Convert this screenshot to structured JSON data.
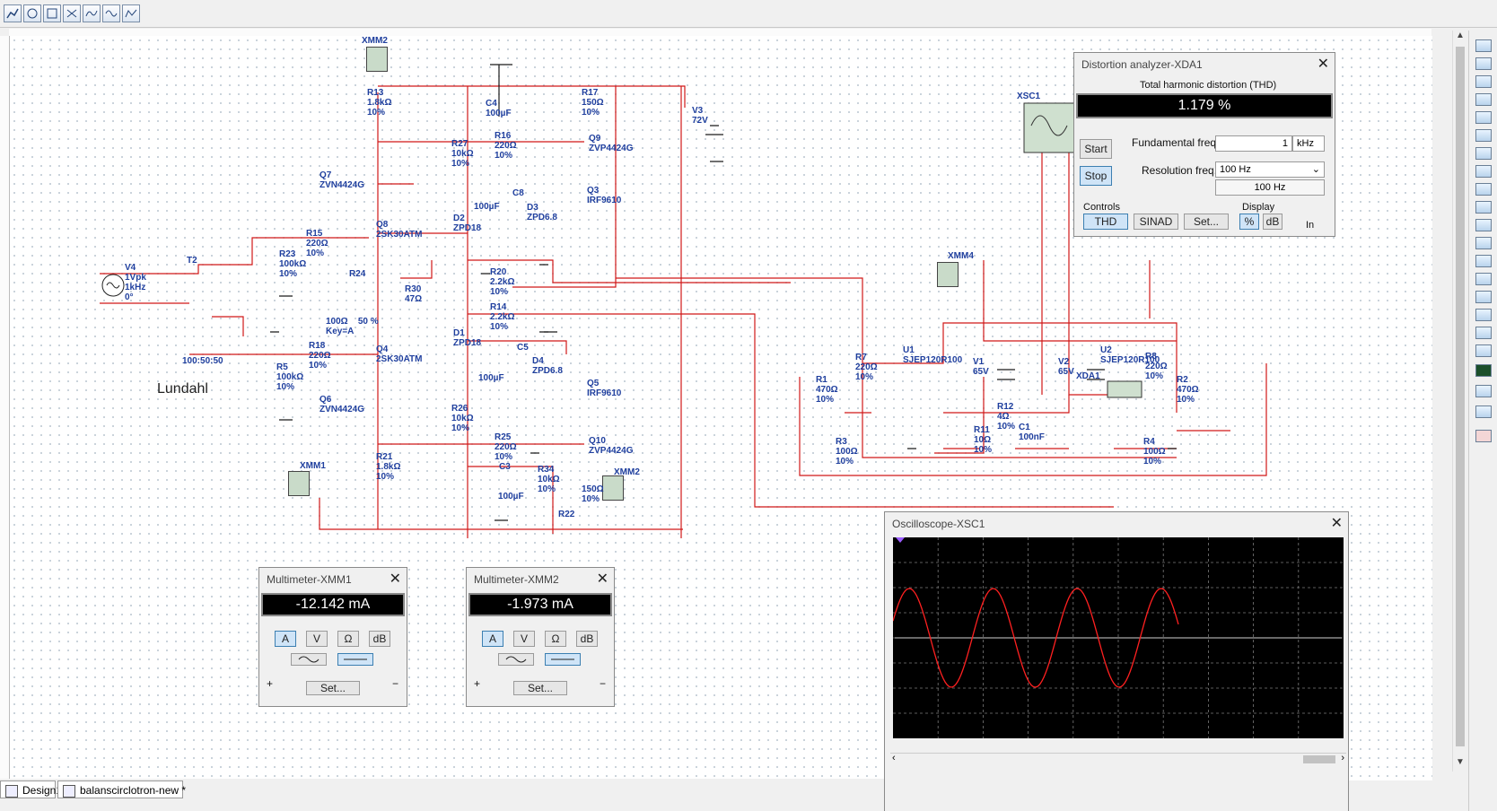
{
  "toolbar": {
    "buttons": [
      "probe-icon",
      "oscilloscope-icon",
      "spectrum-icon",
      "bode-icon",
      "grapher-icon",
      "waveform-icon",
      "network-icon"
    ]
  },
  "tabs": [
    {
      "label": "Design1"
    },
    {
      "label": "balanscirclotron-new *"
    }
  ],
  "schematic": {
    "components": [
      {
        "id": "xmm2_top",
        "text": "XMM2"
      },
      {
        "id": "r13",
        "text": "R13\n1.8kΩ\n10%"
      },
      {
        "id": "c4",
        "text": "C4\n100µF"
      },
      {
        "id": "r17",
        "text": "R17\n150Ω\n10%"
      },
      {
        "id": "v3",
        "text": "V3\n72V"
      },
      {
        "id": "r27",
        "text": "R27\n10kΩ\n10%"
      },
      {
        "id": "r16",
        "text": "R16\n220Ω\n10%"
      },
      {
        "id": "q9",
        "text": "Q9\nZVP4424G"
      },
      {
        "id": "q7",
        "text": "Q7\nZVN4424G"
      },
      {
        "id": "c8",
        "text": "C8"
      },
      {
        "id": "c8v",
        "text": "100µF"
      },
      {
        "id": "q3",
        "text": "Q3\nIRF9610"
      },
      {
        "id": "d2",
        "text": "D2\nZPD18"
      },
      {
        "id": "d3",
        "text": "D3\nZPD6.8"
      },
      {
        "id": "q8",
        "text": "Q8\n2SK30ATM"
      },
      {
        "id": "r15",
        "text": "R15\n220Ω\n10%"
      },
      {
        "id": "r23",
        "text": "R23\n100kΩ\n10%"
      },
      {
        "id": "v4",
        "text": "V4\n1Vpk\n1kHz\n0°"
      },
      {
        "id": "t2",
        "text": "T2"
      },
      {
        "id": "r24",
        "text": "R24"
      },
      {
        "id": "r20",
        "text": "R20\n2.2kΩ\n10%"
      },
      {
        "id": "r30",
        "text": "R30\n47Ω"
      },
      {
        "id": "r24v",
        "text": "100Ω    50 %\nKey=A"
      },
      {
        "id": "r14",
        "text": "R14\n2.2kΩ\n10%"
      },
      {
        "id": "d1",
        "text": "D1\nZPD18"
      },
      {
        "id": "c5",
        "text": "C5"
      },
      {
        "id": "d4",
        "text": "D4\nZPD6.8"
      },
      {
        "id": "c5v",
        "text": "100µF"
      },
      {
        "id": "ratio",
        "text": "100:50:50"
      },
      {
        "id": "r18",
        "text": "R18\n220Ω\n10%"
      },
      {
        "id": "q4",
        "text": "Q4\n2SK30ATM"
      },
      {
        "id": "r5",
        "text": "R5\n100kΩ\n10%"
      },
      {
        "id": "q5",
        "text": "Q5\nIRF9610"
      },
      {
        "id": "q6",
        "text": "Q6\nZVN4424G"
      },
      {
        "id": "r26",
        "text": "R26\n10kΩ\n10%"
      },
      {
        "id": "r25",
        "text": "R25\n220Ω\n10%"
      },
      {
        "id": "q10",
        "text": "Q10\nZVP4424G"
      },
      {
        "id": "c3",
        "text": "C3"
      },
      {
        "id": "r34",
        "text": "R34\n10kΩ\n10%"
      },
      {
        "id": "c3v",
        "text": "100µF"
      },
      {
        "id": "r21",
        "text": "R21\n1.8kΩ\n10%"
      },
      {
        "id": "xmm1_lbl",
        "text": "XMM1"
      },
      {
        "id": "xmm2_lbl",
        "text": "XMM2"
      },
      {
        "id": "r_150",
        "text": "150Ω\n10%"
      },
      {
        "id": "r22",
        "text": "R22"
      },
      {
        "id": "xsc1",
        "text": "XSC1"
      },
      {
        "id": "xmm4",
        "text": "XMM4"
      },
      {
        "id": "r7",
        "text": "R7\n220Ω\n10%"
      },
      {
        "id": "u1",
        "text": "U1\nSJEP120R100"
      },
      {
        "id": "v1",
        "text": "V1\n65V"
      },
      {
        "id": "v2",
        "text": "V2\n65V"
      },
      {
        "id": "u2",
        "text": "U2\nSJEP120R100"
      },
      {
        "id": "r8",
        "text": "R8\n220Ω\n10%"
      },
      {
        "id": "r1",
        "text": "R1\n470Ω\n10%"
      },
      {
        "id": "xda1",
        "text": "XDA1"
      },
      {
        "id": "r2",
        "text": "R2\n470Ω\n10%"
      },
      {
        "id": "r12",
        "text": "R12\n4Ω\n10%"
      },
      {
        "id": "r11",
        "text": "R11\n10Ω\n10%"
      },
      {
        "id": "c1",
        "text": "C1\n100nF"
      },
      {
        "id": "r3",
        "text": "R3\n100Ω\n10%"
      },
      {
        "id": "r4",
        "text": "R4\n100Ω\n10%"
      }
    ],
    "note": "Lundahl"
  },
  "distortion": {
    "title": "Distortion analyzer-XDA1",
    "heading": "Total harmonic distortion (THD)",
    "value": "1.179 %",
    "start": "Start",
    "stop": "Stop",
    "fund_label": "Fundamental freq.",
    "fund_value": "1",
    "fund_unit": "kHz",
    "res_label": "Resolution freq.",
    "res_select": "100 Hz",
    "res_value": "100 Hz",
    "controls_label": "Controls",
    "display_label": "Display",
    "thd": "THD",
    "sinad": "SINAD",
    "set": "Set...",
    "pct": "%",
    "db": "dB",
    "in": "In"
  },
  "multimeter1": {
    "title": "Multimeter-XMM1",
    "value": "-12.142 mA",
    "a": "A",
    "v": "V",
    "ohm": "Ω",
    "db": "dB",
    "set": "Set...",
    "plus": "+",
    "minus": "−"
  },
  "multimeter2": {
    "title": "Multimeter-XMM2",
    "value": "-1.973 mA",
    "a": "A",
    "v": "V",
    "ohm": "Ω",
    "db": "dB",
    "set": "Set...",
    "plus": "+",
    "minus": "−"
  },
  "oscilloscope": {
    "title": "Oscilloscope-XSC1",
    "trace_color": "#ff2020",
    "cycles": 3.4
  }
}
